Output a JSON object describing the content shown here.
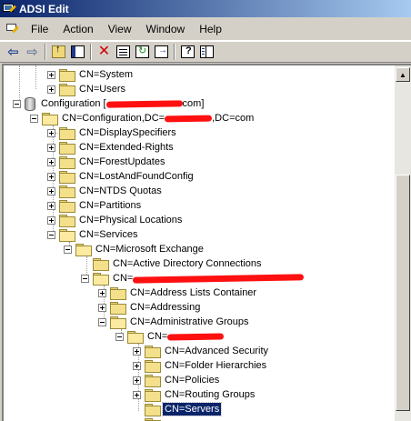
{
  "window": {
    "title": "ADSI Edit"
  },
  "menu": [
    "File",
    "Action",
    "View",
    "Window",
    "Help"
  ],
  "toolbar": {
    "buttons": [
      "back-icon",
      "forward-icon",
      "up-folder-icon",
      "show-hide-tree-icon",
      "delete-icon",
      "properties-icon",
      "refresh-icon",
      "export-list-icon",
      "help-icon",
      "show-hide-action-pane-icon"
    ]
  },
  "tree": {
    "rows": [
      {
        "label": "CN=System",
        "expander": "plus"
      },
      {
        "label": "CN=Users",
        "expander": "plus"
      },
      {
        "label": "Configuration [",
        "suffix": "com]",
        "expander": "minus",
        "redacted": true
      },
      {
        "label": "CN=Configuration,DC=",
        "suffix": ",DC=com",
        "expander": "minus",
        "redacted": true
      },
      {
        "label": "CN=DisplaySpecifiers",
        "expander": "plus"
      },
      {
        "label": "CN=Extended-Rights",
        "expander": "plus"
      },
      {
        "label": "CN=ForestUpdates",
        "expander": "plus"
      },
      {
        "label": "CN=LostAndFoundConfig",
        "expander": "plus"
      },
      {
        "label": "CN=NTDS Quotas",
        "expander": "plus"
      },
      {
        "label": "CN=Partitions",
        "expander": "plus"
      },
      {
        "label": "CN=Physical Locations",
        "expander": "plus"
      },
      {
        "label": "CN=Services",
        "expander": "minus"
      },
      {
        "label": "CN=Microsoft Exchange",
        "expander": "minus"
      },
      {
        "label": "CN=Active Directory Connections",
        "expander": "none"
      },
      {
        "label": "CN=",
        "expander": "minus",
        "redacted": true
      },
      {
        "label": "CN=Address Lists Container",
        "expander": "plus"
      },
      {
        "label": "CN=Addressing",
        "expander": "plus"
      },
      {
        "label": "CN=Administrative Groups",
        "expander": "minus"
      },
      {
        "label": "CN=",
        "expander": "minus",
        "redacted": true
      },
      {
        "label": "CN=Advanced Security",
        "expander": "plus"
      },
      {
        "label": "CN=Folder Hierarchies",
        "expander": "plus"
      },
      {
        "label": "CN=Policies",
        "expander": "plus"
      },
      {
        "label": "CN=Routing Groups",
        "expander": "plus"
      },
      {
        "label": "CN=Servers",
        "expander": "none",
        "selected": true
      }
    ]
  }
}
